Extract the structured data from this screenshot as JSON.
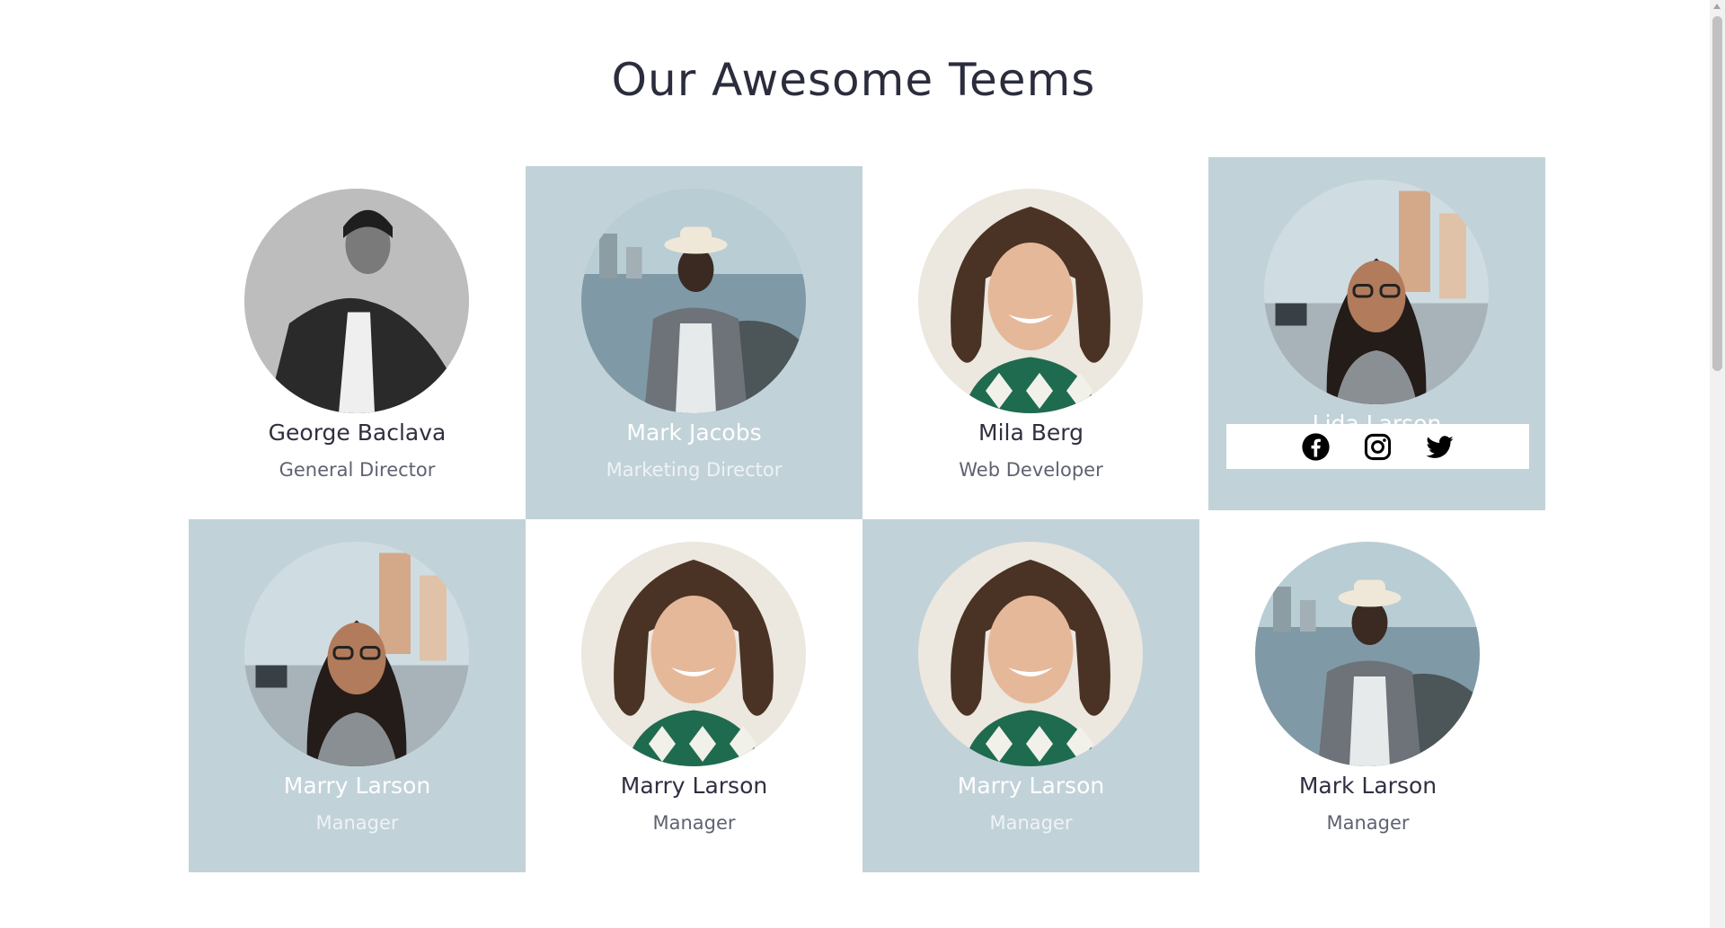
{
  "section": {
    "title": "Our Awesome Teems"
  },
  "team": [
    {
      "name": "George Baclava",
      "role": "General Director",
      "photo": "man-in-black-suit-grayscale"
    },
    {
      "name": "Mark Jacobs",
      "role": "Marketing Director",
      "photo": "man-in-hat-at-seaside"
    },
    {
      "name": "Mila Berg",
      "role": "Web Developer",
      "photo": "smiling-woman-curly-hair"
    },
    {
      "name": "Lida Larson",
      "role": "",
      "photo": "woman-with-glasses-street"
    },
    {
      "name": "Marry Larson",
      "role": "Manager",
      "photo": "woman-with-glasses-street"
    },
    {
      "name": "Marry Larson",
      "role": "Manager",
      "photo": "smiling-woman-curly-hair"
    },
    {
      "name": "Marry Larson",
      "role": "Manager",
      "photo": "smiling-woman-curly-hair"
    },
    {
      "name": "Mark Larson",
      "role": "Manager",
      "photo": "man-in-hat-at-seaside"
    }
  ],
  "social": {
    "icons": [
      "facebook-icon",
      "instagram-icon",
      "twitter-icon"
    ]
  },
  "colors": {
    "card_tint": "#c2d2d9",
    "title": "#2b2d3d",
    "text": "#2f3040",
    "muted": "#5f6270"
  }
}
